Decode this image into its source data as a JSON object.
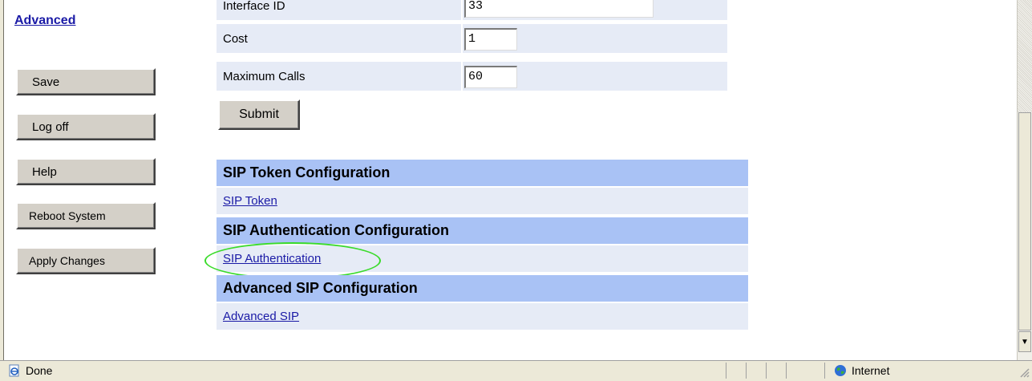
{
  "sidebar": {
    "advanced_link": "Advanced",
    "buttons": [
      "Save",
      "Log off",
      "Help",
      "Reboot System",
      "Apply Changes"
    ]
  },
  "form": {
    "partial_label": "Interface ID",
    "partial_value": "33",
    "rows": [
      {
        "label": "Cost",
        "value": "1"
      },
      {
        "label": "Maximum Calls",
        "value": "60"
      }
    ],
    "submit_label": "Submit"
  },
  "sections": [
    {
      "header": "SIP Token Configuration",
      "link": "SIP Token"
    },
    {
      "header": "SIP Authentication Configuration",
      "link": "SIP Authentication"
    },
    {
      "header": "Advanced SIP Configuration",
      "link": "Advanced SIP"
    }
  ],
  "statusbar": {
    "status": "Done",
    "zone": "Internet"
  },
  "colors": {
    "section_header_bg": "#a9c2f5",
    "row_bg": "#e6ebf6",
    "link": "#1a1aa6",
    "highlight_ellipse": "#3adb2a"
  },
  "icons": {
    "status": "ie-page-icon",
    "zone": "globe-icon",
    "scroll_down": "scroll-down-arrow-icon"
  }
}
